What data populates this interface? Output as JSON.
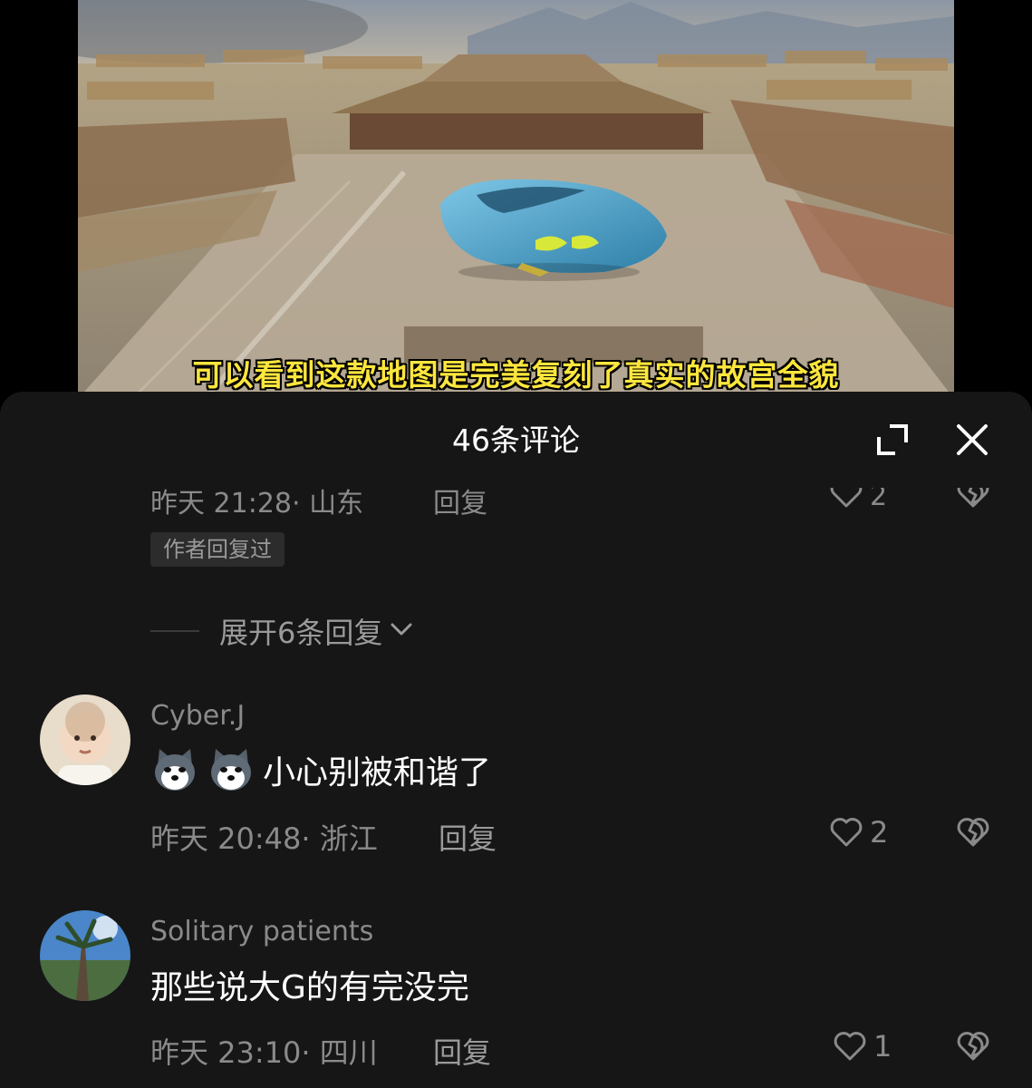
{
  "video": {
    "subtitle": "可以看到这款地图是完美复刻了真实的故宫全貌"
  },
  "sheet": {
    "title": "46条评论",
    "icons": {
      "expand": "expand-icon",
      "close": "close-icon"
    }
  },
  "previous_comment": {
    "meta_cut": "昨天 21:28· 山东",
    "reply_label_cut": "回复",
    "likes_cut": "2",
    "author_tag": "作者回复过",
    "expand_replies": "展开6条回复"
  },
  "comments": [
    {
      "username": "Cyber.J",
      "text": "小心别被和谐了",
      "emojis": [
        "dog-emoji",
        "dog-emoji"
      ],
      "meta": "昨天 20:48· 浙江",
      "reply_label": "回复",
      "likes": "2"
    },
    {
      "username": "Solitary patients",
      "text": "那些说大G的有完没完",
      "meta": "昨天 23:10· 四川",
      "reply_label": "回复",
      "likes": "1"
    }
  ],
  "colors": {
    "sheet_bg": "#161616",
    "subtitle": "#fde63d",
    "muted_text": "#8a8a8a"
  }
}
